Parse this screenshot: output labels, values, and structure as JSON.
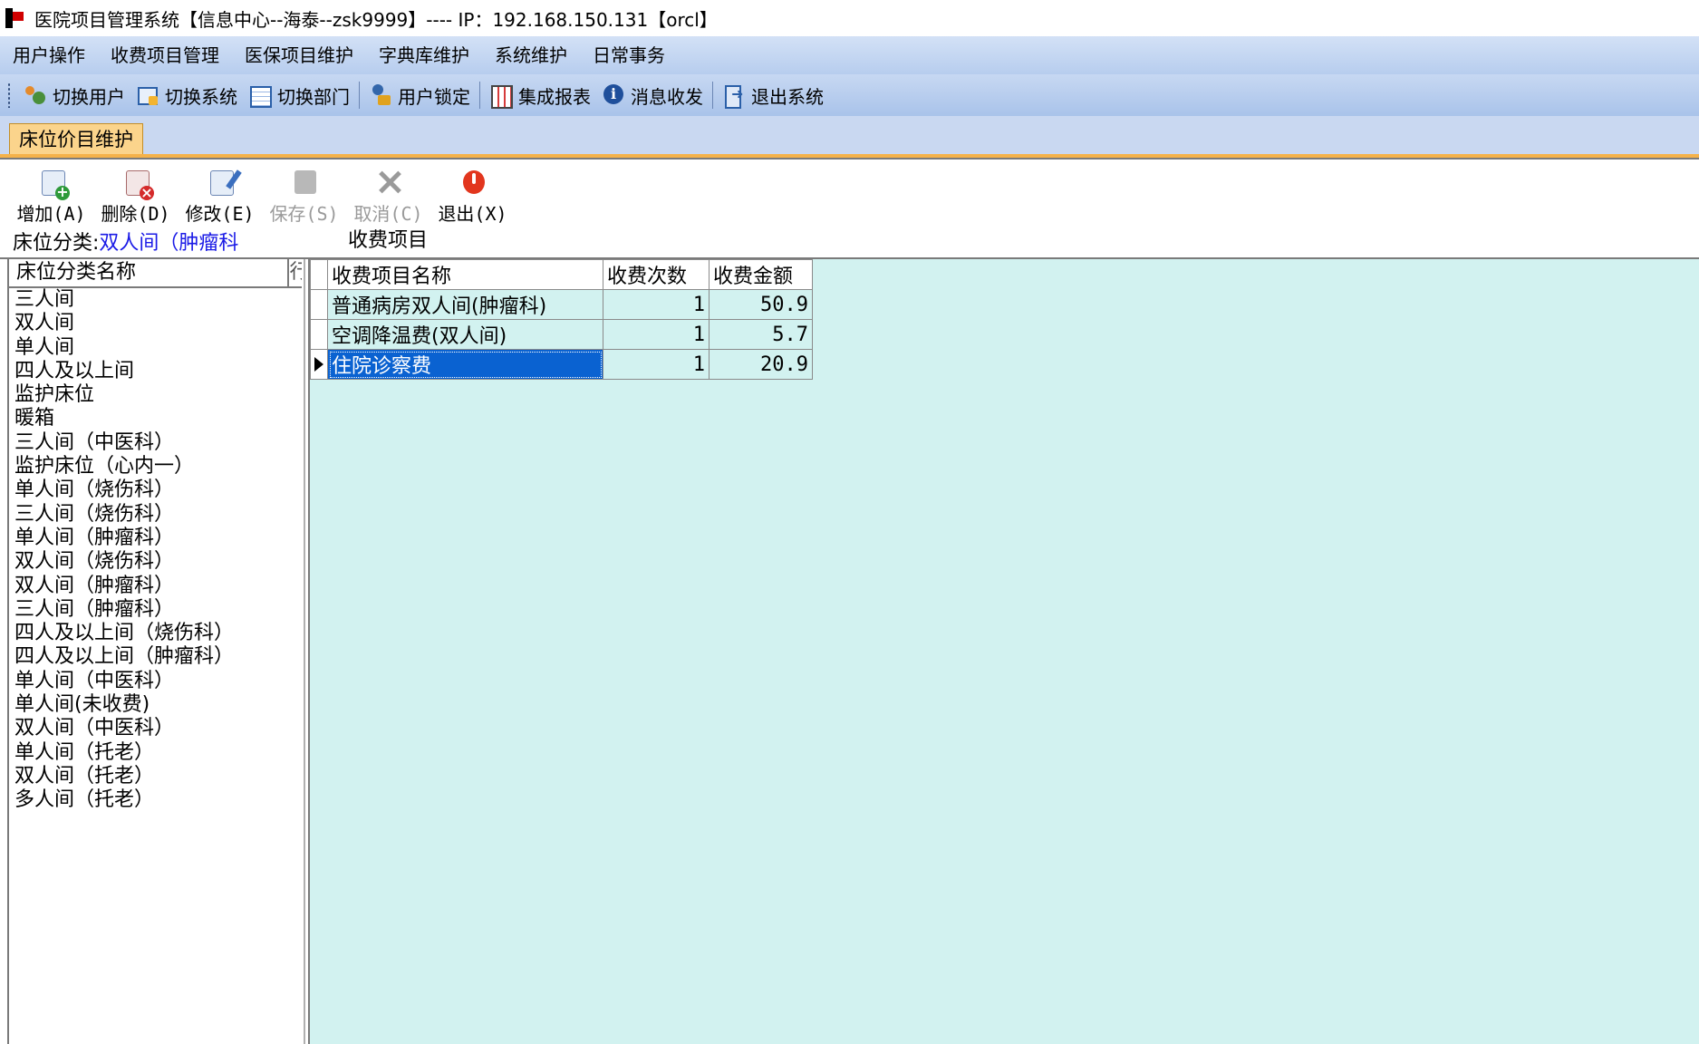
{
  "window": {
    "title": "医院项目管理系统【信息中心--海泰--zsk9999】---- IP：192.168.150.131【orcl】"
  },
  "menu": [
    "用户操作",
    "收费项目管理",
    "医保项目维护",
    "字典库维护",
    "系统维护",
    "日常事务"
  ],
  "toolbar": [
    {
      "label": "切换用户",
      "icon": "switch-user-icon"
    },
    {
      "label": "切换系统",
      "icon": "switch-system-icon"
    },
    {
      "label": "切换部门",
      "icon": "switch-department-icon"
    },
    {
      "label": "用户锁定",
      "icon": "user-lock-icon"
    },
    {
      "label": "集成报表",
      "icon": "report-icon"
    },
    {
      "label": "消息收发",
      "icon": "message-icon"
    },
    {
      "label": "退出系统",
      "icon": "exit-system-icon"
    }
  ],
  "tab": {
    "label": "床位价目维护"
  },
  "actions": [
    {
      "label": "增加(A)",
      "icon": "add-icon",
      "enabled": true
    },
    {
      "label": "删除(D)",
      "icon": "delete-icon",
      "enabled": true
    },
    {
      "label": "修改(E)",
      "icon": "edit-icon",
      "enabled": true
    },
    {
      "label": "保存(S)",
      "icon": "save-icon",
      "enabled": false
    },
    {
      "label": "取消(C)",
      "icon": "cancel-icon",
      "enabled": false
    },
    {
      "label": "退出(X)",
      "icon": "power-icon",
      "enabled": true
    }
  ],
  "bed_category": {
    "label": "床位分类:",
    "value": "双人间（肿瘤科"
  },
  "fee_section_title": "收费项目",
  "left_list": {
    "header": "床位分类名称",
    "header2": "行",
    "items": [
      "三人间",
      "双人间",
      "单人间",
      "四人及以上间",
      "监护床位",
      "暖箱",
      "三人间（中医科）",
      "监护床位（心内一）",
      "单人间（烧伤科）",
      "三人间（烧伤科）",
      "单人间（肿瘤科）",
      "双人间（烧伤科）",
      "双人间（肿瘤科）",
      "三人间（肿瘤科）",
      "四人及以上间（烧伤科）",
      "四人及以上间（肿瘤科）",
      "单人间（中医科）",
      "单人间(未收费)",
      "双人间（中医科）",
      "单人间（托老）",
      "双人间（托老）",
      "多人间（托老）"
    ]
  },
  "fee_grid": {
    "columns": [
      "收费项目名称",
      "收费次数",
      "收费金额"
    ],
    "rows": [
      {
        "name": "普通病房双人间(肿瘤科)",
        "count": "1",
        "amount": "50.9"
      },
      {
        "name": "空调降温费(双人间)",
        "count": "1",
        "amount": "5.7"
      },
      {
        "name": "住院诊察费",
        "count": "1",
        "amount": "20.9"
      }
    ]
  }
}
